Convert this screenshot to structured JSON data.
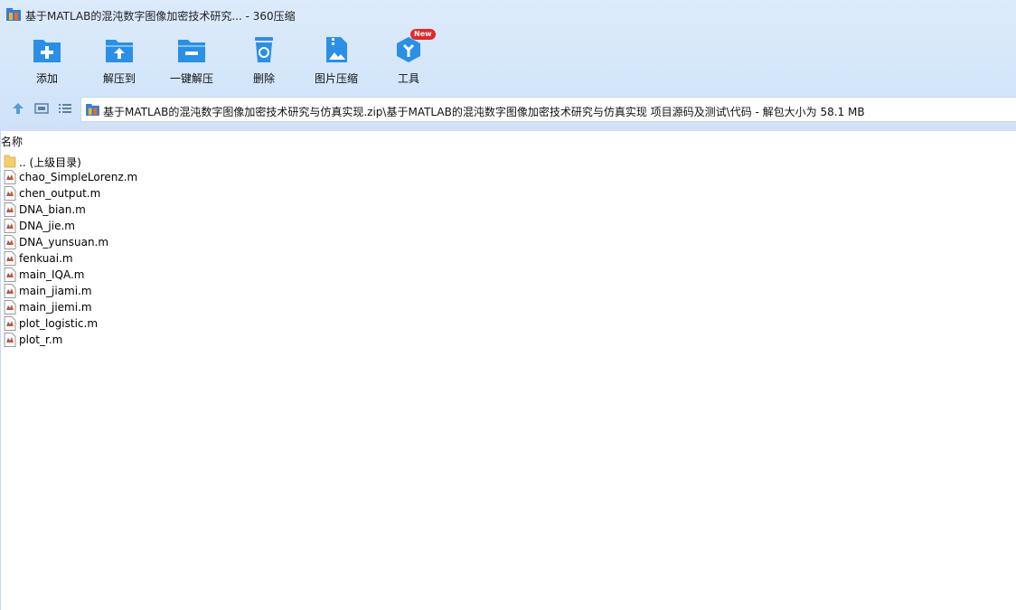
{
  "window": {
    "title": "基于MATLAB的混沌数字图像加密技术研究... - 360压缩"
  },
  "toolbar": {
    "add": "添加",
    "extract_to": "解压到",
    "one_click_extract": "一键解压",
    "delete": "删除",
    "image_compress": "图片压缩",
    "tools": "工具",
    "tools_badge": "New"
  },
  "nav": {
    "address": "基于MATLAB的混沌数字图像加密技术研究与仿真实现.zip\\基于MATLAB的混沌数字图像加密技术研究与仿真实现 项目源码及测试\\代码 - 解包大小为 58.1 MB"
  },
  "list": {
    "column_name": "名称",
    "parent": ".. (上级目录)",
    "files": [
      "chao_SimpleLorenz.m",
      "chen_output.m",
      "DNA_bian.m",
      "DNA_jie.m",
      "DNA_yunsuan.m",
      "fenkuai.m",
      "main_IQA.m",
      "main_jiami.m",
      "main_jiemi.m",
      "plot_logistic.m",
      "plot_r.m"
    ]
  },
  "colors": {
    "accent_blue": "#2b8fe5",
    "badge_red": "#e5262c",
    "top_bg": "#d8e8fa"
  },
  "icons": [
    "add-icon",
    "extract-to-icon",
    "one-click-extract-icon",
    "delete-icon",
    "image-compress-icon",
    "tools-icon",
    "up-arrow-icon",
    "thumbnail-view-icon",
    "list-view-icon",
    "folder-icon",
    "matlab-file-icon"
  ]
}
